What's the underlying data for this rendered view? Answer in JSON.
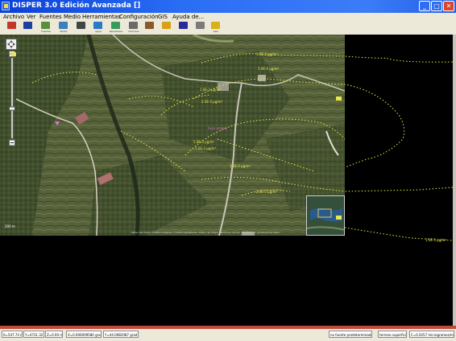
{
  "window": {
    "title": "DISPER 3.0 Edición Avanzada []",
    "minimize": "_",
    "maximize": "□",
    "close": "✕"
  },
  "menu": [
    "Archivo",
    "Ver",
    "Fuentes",
    "Medio",
    "Herramientas",
    "Configuración",
    "GIS",
    "Ayuda de..."
  ],
  "toolbar": [
    {
      "label": "",
      "icon": "edit-icon",
      "color": "#c0392b"
    },
    {
      "label": "",
      "icon": "save-icon",
      "color": "#1f3f9f"
    },
    {
      "label": "Fuentes",
      "icon": "sources-icon",
      "color": "#5a8f3a"
    },
    {
      "label": "Medio",
      "icon": "environment-icon",
      "color": "#3a7fbf"
    },
    {
      "label": "",
      "icon": "stack-icon",
      "color": "#444444"
    },
    {
      "label": "Agua",
      "icon": "water-icon",
      "color": "#2a78c8"
    },
    {
      "label": "Resultados",
      "icon": "results-icon",
      "color": "#3a9a5a"
    },
    {
      "label": "Informes",
      "icon": "report-icon",
      "color": "#6a6a6a"
    },
    {
      "label": "",
      "icon": "chart-icon",
      "color": "#8a5a2a"
    },
    {
      "label": "",
      "icon": "sign-icon",
      "color": "#d9a017"
    },
    {
      "label": "",
      "icon": "cross-icon",
      "color": "#2a2a9a"
    },
    {
      "label": "",
      "icon": "satellite-icon",
      "color": "#7a7a7a"
    },
    {
      "label": "Salir",
      "icon": "exit-icon",
      "color": "#d9b017"
    }
  ],
  "map": {
    "scale": "200 m",
    "attribution": "Datos del mapa ©2018 Imágenes ©2018 DigitalGlobe, Datos del mapa · Términos de uso · Notificar un problema de Maps"
  },
  "status": [
    "0=547.74 m",
    "Y=4731.32 m",
    "Z=0.00 m",
    "X=0.000009580 grad",
    "Y=44.0082087 grad",
    "no fuente predeterminada",
    "terreno superficie",
    "C=0.0257 microgramos/m^3"
  ],
  "colors": {
    "titlebar": "#1d56e6",
    "workspace": "#000000",
    "contour": "#e8e84a",
    "source_marker": "#e070e0"
  }
}
